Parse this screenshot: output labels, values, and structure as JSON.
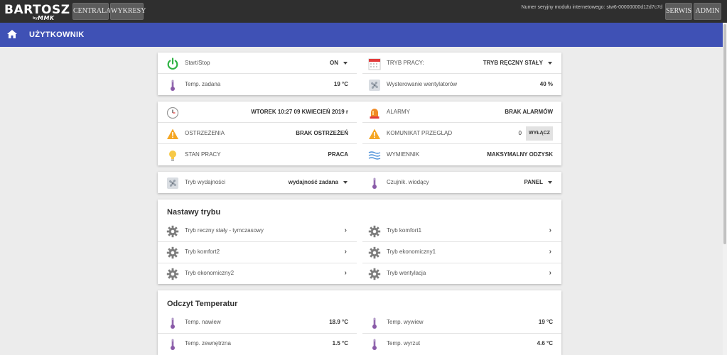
{
  "topbar": {
    "logo_word": "BARTOSZ",
    "logo_by": "by",
    "logo_brand": "MMK",
    "nav": [
      "CENTRALA",
      "WYKRESY"
    ],
    "serial_label": "Numer seryjny modułu internetowego:",
    "serial_value": "stw6-00000000d12d7c7d",
    "right_buttons": [
      "SERWIS",
      "ADMIN"
    ]
  },
  "header": {
    "title": "UŻYTKOWNIK"
  },
  "card1": {
    "start_stop": {
      "label": "Start/Stop",
      "value": "ON"
    },
    "tryb_pracy": {
      "label": "TRYB PRACY:",
      "value": "TRYB RĘCZNY STAŁY"
    },
    "temp_zadana": {
      "label": "Temp. zadana",
      "value": "19 °C"
    },
    "wysterowanie": {
      "label": "Wysterowanie wentylatorów",
      "value": "40 %"
    }
  },
  "card2": {
    "datetime": {
      "value": "WTOREK 10:27 09 KWIECIEŃ 2019 r"
    },
    "alarmy": {
      "label": "ALARMY",
      "value": "BRAK ALARMÓW"
    },
    "ostrzezenia": {
      "label": "OSTRZEŻENIA",
      "value": "BRAK OSTRZEŻEŃ"
    },
    "komunikat": {
      "label": "KOMUNIKAT PRZEGLĄD",
      "value": "0",
      "button": "WYŁĄCZ"
    },
    "stan_pracy": {
      "label": "STAN PRACY",
      "value": "PRACA"
    },
    "wymiennik": {
      "label": "WYMIENNIK",
      "value": "MAKSYMALNY ODZYSK"
    }
  },
  "card3": {
    "tryb_wydajnosci": {
      "label": "Tryb wydajności",
      "value": "wydajność zadana"
    },
    "czujnik": {
      "label": "Czujnik. wiodący",
      "value": "PANEL"
    }
  },
  "nastawy": {
    "title": "Nastawy trybu",
    "items": [
      "Tryb reczny stały - tymczasowy",
      "Tryb komfort1",
      "Tryb komfort2",
      "Tryb ekonomiczny1",
      "Tryb ekonomiczny2",
      "Tryb wentylacja"
    ]
  },
  "odczyt": {
    "title": "Odczyt Temperatur",
    "items": [
      {
        "label": "Temp. nawiew",
        "value": "18.9 °C"
      },
      {
        "label": "Temp. wywiew",
        "value": "19 °C"
      },
      {
        "label": "Temp. zewnętrzna",
        "value": "1.5 °C"
      },
      {
        "label": "Temp. wyrzut",
        "value": "4.6 °C"
      }
    ]
  },
  "icons": {
    "power": "power-icon",
    "calendar": "calendar-icon",
    "thermometer": "thermometer-icon",
    "fan": "fan-icon",
    "clock": "clock-icon",
    "alarm": "alarm-light-icon",
    "warning": "warning-icon",
    "bulb": "lightbulb-icon",
    "exchanger": "heat-exchanger-icon",
    "gear": "gear-icon"
  },
  "colors": {
    "topbar": "#2f2f2f",
    "header": "#3f51b5",
    "power_green": "#2fb344",
    "warning_orange": "#f5a623",
    "thermo_purple": "#8a5aa8"
  }
}
